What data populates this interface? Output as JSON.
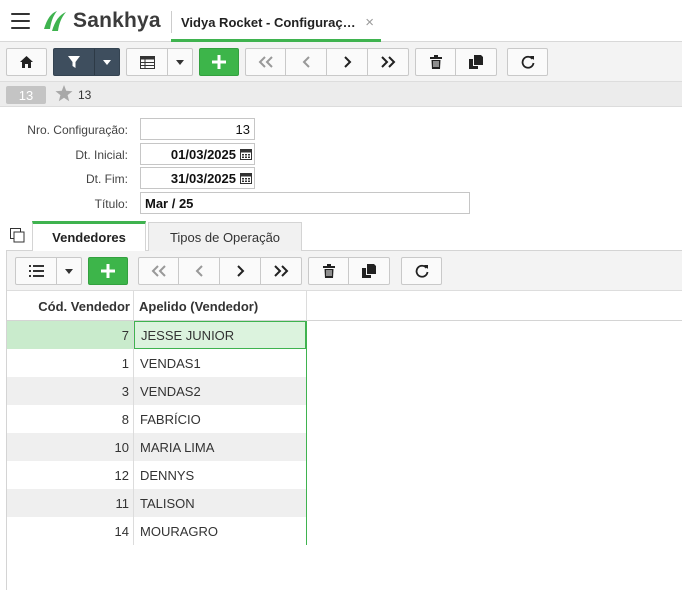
{
  "header": {
    "logo_text": "Sankhya",
    "tab_title": "Vidya Rocket - Configuraç…",
    "tab_close": "×"
  },
  "record_bar": {
    "badge": "13",
    "number": "13"
  },
  "form": {
    "nro_label": "Nro. Configuração:",
    "nro_value": "13",
    "dt_inicial_label": "Dt. Inicial:",
    "dt_inicial_value": "01/03/2025",
    "dt_fim_label": "Dt. Fim:",
    "dt_fim_value": "31/03/2025",
    "titulo_label": "Título:",
    "titulo_value": "Mar / 25"
  },
  "tabs": [
    {
      "label": "Vendedores",
      "active": true
    },
    {
      "label": "Tipos de Operação",
      "active": false
    }
  ],
  "grid": {
    "columns": [
      "Cód. Vendedor",
      "Apelido (Vendedor)"
    ],
    "rows": [
      {
        "cod": "7",
        "apelido": "JESSE JUNIOR"
      },
      {
        "cod": "1",
        "apelido": "VENDAS1"
      },
      {
        "cod": "3",
        "apelido": "VENDAS2"
      },
      {
        "cod": "8",
        "apelido": "FABRÍCIO"
      },
      {
        "cod": "10",
        "apelido": "MARIA LIMA"
      },
      {
        "cod": "12",
        "apelido": "DENNYS"
      },
      {
        "cod": "11",
        "apelido": "TALISON"
      },
      {
        "cod": "14",
        "apelido": "MOURAGRO"
      }
    ],
    "selected_index": 0
  },
  "colors": {
    "accent": "#3fb34f",
    "dark_button": "#3e4e5e",
    "selected_row": "#c9ebcc"
  }
}
